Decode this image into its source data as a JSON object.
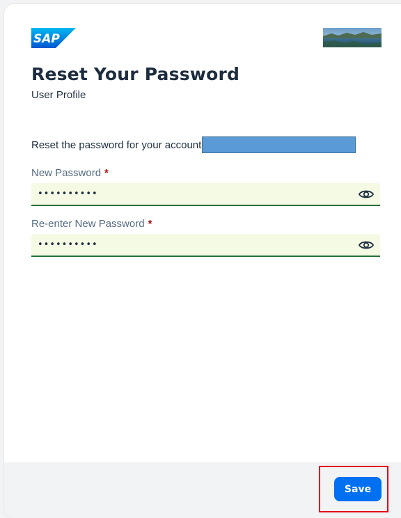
{
  "header": {
    "logo_text": "SAP",
    "title": "Reset Your Password",
    "subtitle": "User Profile"
  },
  "form": {
    "account_prompt": "Reset the password for your account",
    "required_marker": "*",
    "new_password": {
      "label": "New Password",
      "value": "••••••••••"
    },
    "reenter_password": {
      "label": "Re-enter New Password",
      "value": "••••••••••"
    }
  },
  "footer": {
    "save_label": "Save"
  },
  "icons": {
    "logo": "sap-logo",
    "visibility": "eye-icon"
  },
  "colors": {
    "title": "#1d2d3e",
    "label": "#556b82",
    "required": "#aa0808",
    "field_background": "#f5fae5",
    "field_border_success": "#256f3a",
    "primary_button": "#0070f2",
    "highlight": "#e0001b",
    "redaction": "#5b9bd5"
  }
}
